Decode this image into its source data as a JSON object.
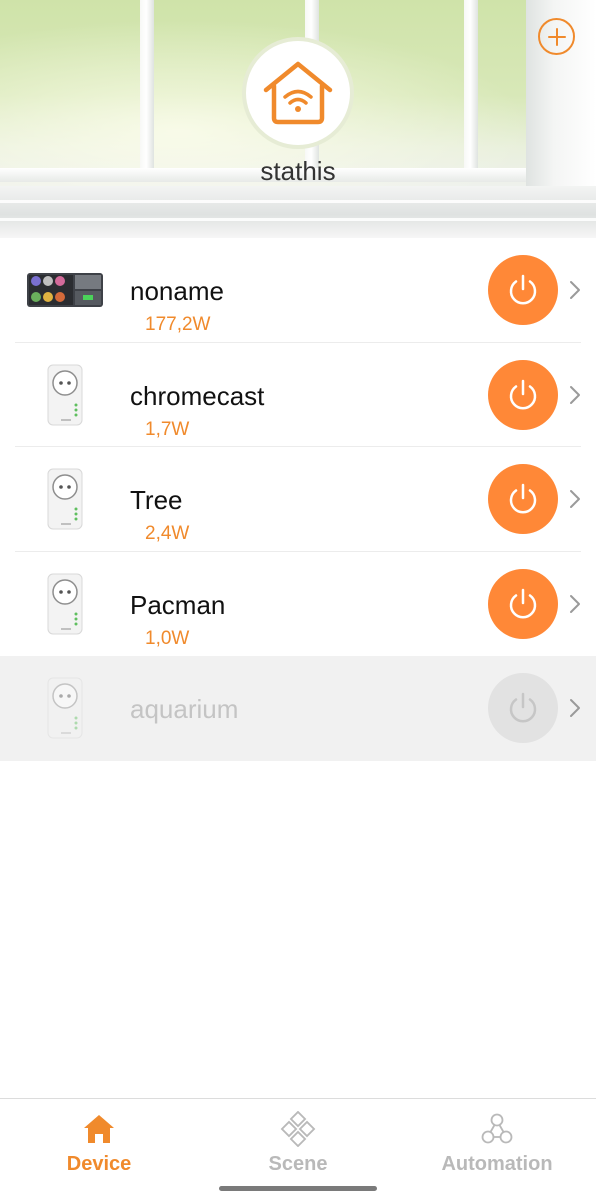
{
  "header": {
    "home_name": "stathis",
    "add_icon": "plus-circle-icon",
    "home_icon": "smart-home-wifi-icon",
    "accent_color": "#f08a2c"
  },
  "devices": [
    {
      "name": "noname",
      "power": "177,2W",
      "thumb": "power-strip-image",
      "online": true
    },
    {
      "name": "chromecast",
      "power": "1,7W",
      "thumb": "smart-plug-image",
      "online": true
    },
    {
      "name": "Tree",
      "power": "2,4W",
      "thumb": "smart-plug-image",
      "online": true
    },
    {
      "name": "Pacman",
      "power": "1,0W",
      "thumb": "smart-plug-image",
      "online": true
    },
    {
      "name": "aquarium",
      "power": "",
      "thumb": "smart-plug-image",
      "online": false
    }
  ],
  "colors": {
    "power_on": "#ff8837",
    "power_offline": "#e2e2e2",
    "watt_text": "#f08a2c",
    "inactive_tab": "#b9b9b9"
  },
  "tabs": [
    {
      "label": "Device",
      "icon": "home-icon",
      "active": true
    },
    {
      "label": "Scene",
      "icon": "scene-diamond-icon",
      "active": false
    },
    {
      "label": "Automation",
      "icon": "automation-nodes-icon",
      "active": false
    }
  ]
}
